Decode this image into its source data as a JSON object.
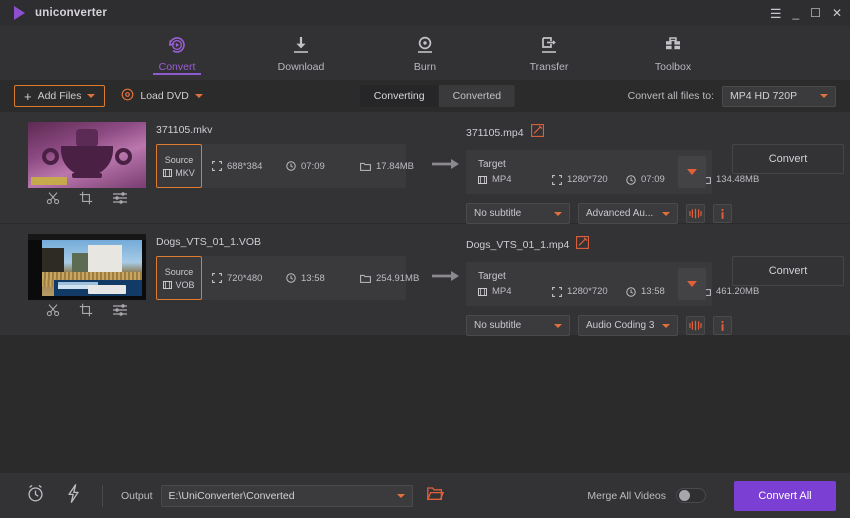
{
  "titlebar": {
    "app_title": "uniconverter",
    "logo_icon": "play-triangle-icon",
    "menu_icon": "hamburger-menu-icon",
    "minimize_icon": "minimize-icon",
    "maximize_icon": "maximize-icon",
    "close_icon": "close-icon",
    "accent_purple": "#8e4fd0"
  },
  "nav": {
    "items": [
      {
        "label": "Convert",
        "icon": "convert-circle-arrow-icon",
        "active": true
      },
      {
        "label": "Download",
        "icon": "download-arrow-icon",
        "active": false
      },
      {
        "label": "Burn",
        "icon": "disc-burn-icon",
        "active": false
      },
      {
        "label": "Transfer",
        "icon": "transfer-arrow-icon",
        "active": false
      },
      {
        "label": "Toolbox",
        "icon": "toolbox-icon",
        "active": false
      }
    ],
    "active_color": "#9a5fd6",
    "rule_color": "#5c4d74"
  },
  "toolbar": {
    "add_files_label": "Add Files",
    "add_files_icon": "plus-icon",
    "add_files_border": "#e07b2e",
    "load_dvd_label": "Load DVD",
    "load_dvd_icon": "disc-icon",
    "tabs": [
      {
        "label": "Converting",
        "active": true
      },
      {
        "label": "Converted",
        "active": false
      }
    ],
    "convert_all_to_label": "Convert all files to:",
    "format_value": "MP4 HD 720P"
  },
  "files": [
    {
      "thumb_tools": [
        "trim-scissors-icon",
        "crop-icon",
        "effects-sliders-icon"
      ],
      "source_name": "371105.mkv",
      "source": {
        "badge_label": "Source",
        "format": "MKV",
        "resolution": "688*384",
        "duration": "07:09",
        "size": "17.84MB"
      },
      "target_name": "371105.mp4",
      "target": {
        "badge_label": "Target",
        "format": "MP4",
        "resolution": "1280*720",
        "duration": "07:09",
        "size": "134.48MB"
      },
      "subtitle_value": "No subtitle",
      "audio_value": "Advanced Au...",
      "convert_label": "Convert"
    },
    {
      "thumb_tools": [
        "trim-scissors-icon",
        "crop-icon",
        "effects-sliders-icon"
      ],
      "source_name": "Dogs_VTS_01_1.VOB",
      "source": {
        "badge_label": "Source",
        "format": "VOB",
        "resolution": "720*480",
        "duration": "13:58",
        "size": "254.91MB"
      },
      "target_name": "Dogs_VTS_01_1.mp4",
      "target": {
        "badge_label": "Target",
        "format": "MP4",
        "resolution": "1280*720",
        "duration": "13:58",
        "size": "461.20MB"
      },
      "subtitle_value": "No subtitle",
      "audio_value": "Audio Coding 3",
      "convert_label": "Convert"
    }
  ],
  "bottombar": {
    "alarm_icon": "alarm-clock-icon",
    "bolt_icon": "lightning-bolt-icon",
    "output_label": "Output",
    "output_path": "E:\\UniConverter\\Converted",
    "folder_icon": "open-folder-icon",
    "merge_label": "Merge All Videos",
    "merge_enabled": false,
    "convert_all_label": "Convert All",
    "convert_all_color": "#7b3fd4"
  }
}
